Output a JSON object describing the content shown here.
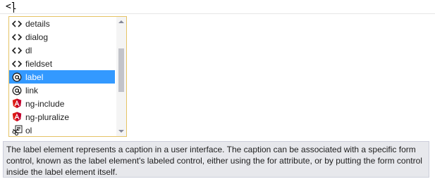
{
  "editor": {
    "typed_text": "<l"
  },
  "completion": {
    "items": [
      {
        "label": "details",
        "icon": "element-tag-icon",
        "selected": false
      },
      {
        "label": "dialog",
        "icon": "element-tag-icon",
        "selected": false
      },
      {
        "label": "dl",
        "icon": "element-tag-icon",
        "selected": false
      },
      {
        "label": "fieldset",
        "icon": "element-tag-icon",
        "selected": false
      },
      {
        "label": "label",
        "icon": "at-sign-icon",
        "selected": true
      },
      {
        "label": "link",
        "icon": "at-sign-icon",
        "selected": false
      },
      {
        "label": "ng-include",
        "icon": "angular-icon",
        "selected": false
      },
      {
        "label": "ng-pluralize",
        "icon": "angular-icon",
        "selected": false
      },
      {
        "label": "ol",
        "icon": "snippet-icon",
        "selected": false
      }
    ]
  },
  "tooltip": {
    "text": "The label element represents a caption in a user interface. The caption can be associated with a specific form control, known as the label element's labeled control, either using the for attribute, or by putting the form control inside the label element itself."
  },
  "colors": {
    "selection": "#3399ff",
    "popup_border": "#e5c365",
    "tooltip_background": "#e7e8ec",
    "angular_red": "#dd1b16"
  }
}
